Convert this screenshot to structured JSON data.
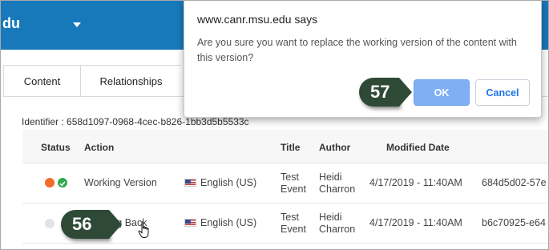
{
  "app": {
    "brand": "du"
  },
  "tabs": [
    {
      "label": "Content"
    },
    {
      "label": "Relationships"
    }
  ],
  "identifier": "Identifier : 658d1097-0968-4cec-b826-1bb3d5b5533c",
  "table": {
    "columns": [
      "Status",
      "Action",
      "Title",
      "Author",
      "Modified Date"
    ],
    "rows": [
      {
        "action": "Working Version",
        "language": "English (US)",
        "title": "Test Event",
        "author": "Heidi Charron",
        "modified": "4/17/2019 - 11:40AM",
        "id": "684d5d02-57e"
      },
      {
        "action": "e - Bring Back",
        "language": "English (US)",
        "title": "Test Event",
        "author": "Heidi Charron",
        "modified": "4/17/2019 - 11:40AM",
        "id": "b6c70925-e64"
      }
    ]
  },
  "dialog": {
    "title": "www.canr.msu.edu says",
    "message": "Are you sure you want to replace the working version of the content with this version?",
    "ok_label": "OK",
    "cancel_label": "Cancel"
  },
  "callouts": {
    "step_ok": "57",
    "step_bring_back": "56"
  },
  "colors": {
    "appbar": "#1779ba",
    "callout": "#2e4a37",
    "ok_button": "#7fb0f5",
    "status_orange": "#f26b2b",
    "status_green": "#2fa84f"
  },
  "icons": {
    "status_working": "check-circle-icon",
    "status_inactive": "circle-icon",
    "language": "us-flag-icon",
    "pointer": "hand-cursor-icon"
  }
}
